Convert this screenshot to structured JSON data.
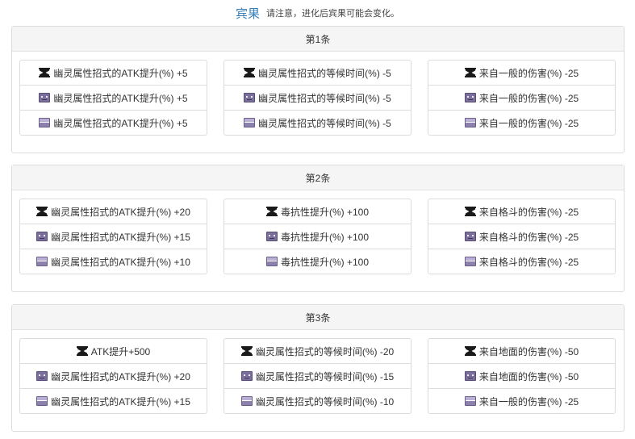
{
  "header": {
    "title": "宾果",
    "note": "请注意，进化后宾果可能会变化。"
  },
  "panels": [
    {
      "title": "第1条",
      "columns": [
        [
          {
            "icon": "rank-gold-icon",
            "text": "幽灵属性招式的ATK提升(%) +5"
          },
          {
            "icon": "rank-silver-icon",
            "text": "幽灵属性招式的ATK提升(%) +5"
          },
          {
            "icon": "rank-bronze-icon",
            "text": "幽灵属性招式的ATK提升(%) +5"
          }
        ],
        [
          {
            "icon": "rank-gold-icon",
            "text": "幽灵属性招式的等候时间(%) -5"
          },
          {
            "icon": "rank-silver-icon",
            "text": "幽灵属性招式的等候时间(%) -5"
          },
          {
            "icon": "rank-bronze-icon",
            "text": "幽灵属性招式的等候时间(%) -5"
          }
        ],
        [
          {
            "icon": "rank-gold-icon",
            "text": "来自一般的伤害(%) -25"
          },
          {
            "icon": "rank-silver-icon",
            "text": "来自一般的伤害(%) -25"
          },
          {
            "icon": "rank-bronze-icon",
            "text": "来自一般的伤害(%) -25"
          }
        ]
      ]
    },
    {
      "title": "第2条",
      "columns": [
        [
          {
            "icon": "rank-gold-icon",
            "text": "幽灵属性招式的ATK提升(%) +20"
          },
          {
            "icon": "rank-silver-icon",
            "text": "幽灵属性招式的ATK提升(%) +15"
          },
          {
            "icon": "rank-bronze-icon",
            "text": "幽灵属性招式的ATK提升(%) +10"
          }
        ],
        [
          {
            "icon": "rank-gold-icon",
            "text": "毒抗性提升(%) +100"
          },
          {
            "icon": "rank-silver-icon",
            "text": "毒抗性提升(%) +100"
          },
          {
            "icon": "rank-bronze-icon",
            "text": "毒抗性提升(%) +100"
          }
        ],
        [
          {
            "icon": "rank-gold-icon",
            "text": "来自格斗的伤害(%) -25"
          },
          {
            "icon": "rank-silver-icon",
            "text": "来自格斗的伤害(%) -25"
          },
          {
            "icon": "rank-bronze-icon",
            "text": "来自格斗的伤害(%) -25"
          }
        ]
      ]
    },
    {
      "title": "第3条",
      "columns": [
        [
          {
            "icon": "rank-gold-icon",
            "text": "ATK提升+500"
          },
          {
            "icon": "rank-silver-icon",
            "text": "幽灵属性招式的ATK提升(%) +20"
          },
          {
            "icon": "rank-bronze-icon",
            "text": "幽灵属性招式的ATK提升(%) +15"
          }
        ],
        [
          {
            "icon": "rank-gold-icon",
            "text": "幽灵属性招式的等候时间(%) -20"
          },
          {
            "icon": "rank-silver-icon",
            "text": "幽灵属性招式的等候时间(%) -15"
          },
          {
            "icon": "rank-bronze-icon",
            "text": "幽灵属性招式的等候时间(%) -10"
          }
        ],
        [
          {
            "icon": "rank-gold-icon",
            "text": "来自地面的伤害(%) -50"
          },
          {
            "icon": "rank-silver-icon",
            "text": "来自地面的伤害(%) -50"
          },
          {
            "icon": "rank-bronze-icon",
            "text": "来自一般的伤害(%) -25"
          }
        ]
      ]
    }
  ]
}
